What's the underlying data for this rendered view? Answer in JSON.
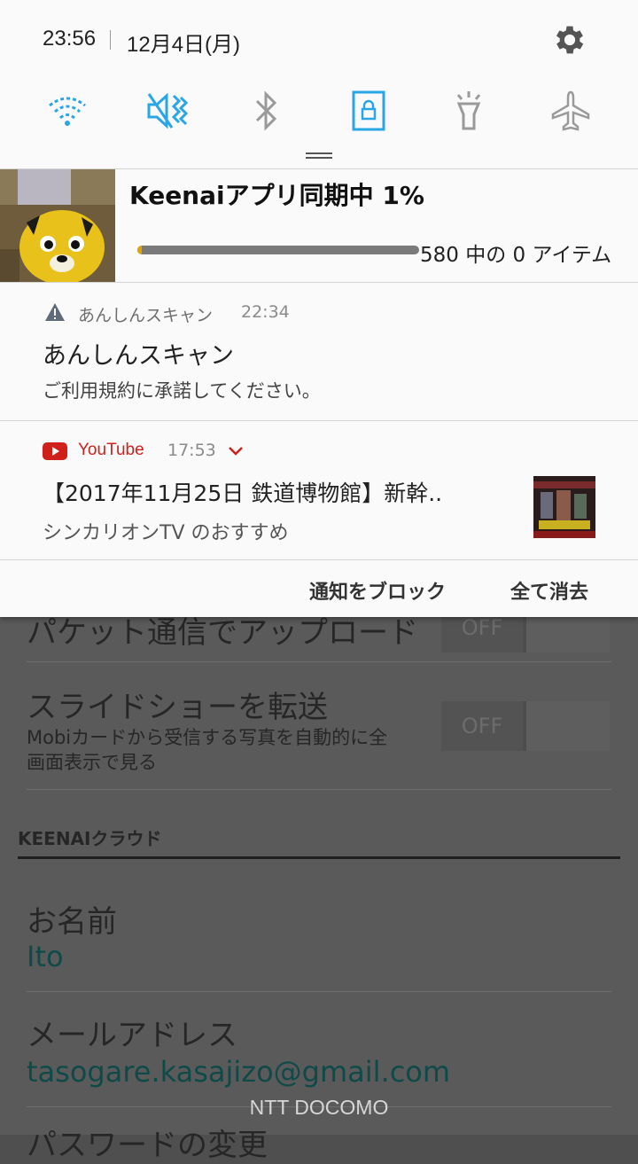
{
  "status_bar": {
    "time": "23:56",
    "date": "12月4日(月)"
  },
  "quick_settings": {
    "icons": [
      "wifi-icon",
      "vibrate-icon",
      "bluetooth-icon",
      "screen-rotation-lock-icon",
      "flashlight-icon",
      "airplane-mode-icon"
    ],
    "active_color": "#2aa5e6",
    "inactive_color": "#9a9a9a"
  },
  "notifications": {
    "keenai": {
      "title": "Keenaiアプリ同期中 1%",
      "progress": 0.01,
      "count_text": "580 中の 0 アイテム"
    },
    "anshin": {
      "app": "あんしんスキャン",
      "time": "22:34",
      "title": "あんしんスキャン",
      "text": "ご利用規約に承諾してください。"
    },
    "youtube": {
      "app": "YouTube",
      "time": "17:53",
      "title": "【2017年11月25日 鉄道博物館】新幹..",
      "subtitle": "シンカリオンTV のおすすめ",
      "brand_color": "#d0201a"
    }
  },
  "actions": {
    "block": "通知をブロック",
    "clear_all": "全て消去"
  },
  "background_app": {
    "packet_upload": "パケット通信でアップロード",
    "packet_toggle": "OFF",
    "slideshow_title": "スライドショーを転送",
    "slideshow_desc_1": "Mobiカードから受信する写真を自動的に全",
    "slideshow_desc_2": "画面表示で見る",
    "slideshow_toggle": "OFF",
    "section": "KEENAIクラウド",
    "name_label": "お名前",
    "name_value": "Ito",
    "email_label": "メールアドレス",
    "email_value": "tasogare.kasajizo@gmail.com",
    "next_label": "パスワードの変更"
  },
  "carrier": "NTT DOCOMO"
}
